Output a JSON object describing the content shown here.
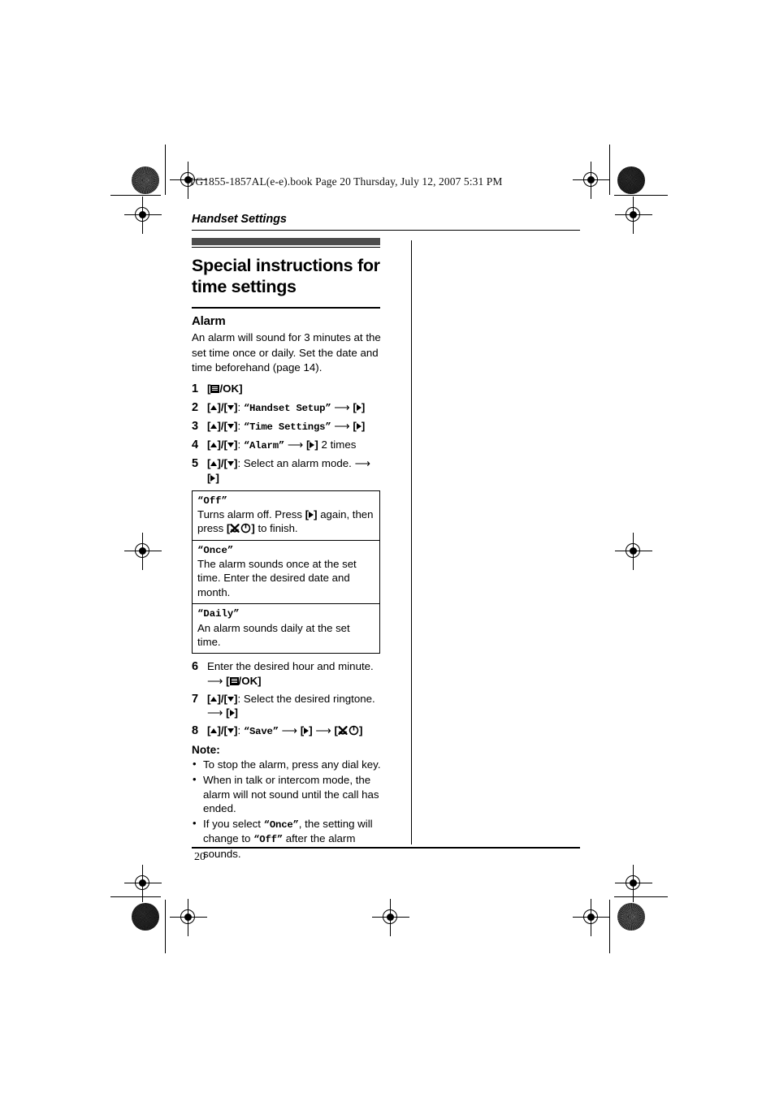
{
  "print_marks": {
    "book_header": "TG1855-1857AL(e-e).book  Page 20  Thursday, July 12, 2007  5:31 PM"
  },
  "page": {
    "running_head": "Handset Settings",
    "title": "Special instructions for time settings",
    "folio": "20"
  },
  "section": {
    "subhead": "Alarm",
    "intro": "An alarm will sound for 3 minutes at the set time once or daily. Set the date and time beforehand (page 14)."
  },
  "steps": [
    {
      "num": "1",
      "parts": [
        {
          "type": "key",
          "glyph": "menu-ok",
          "text": "[▤/OK]"
        }
      ]
    },
    {
      "num": "2",
      "parts": [
        {
          "type": "key",
          "glyph": "up-down",
          "text": "[▲]/[▼]"
        },
        {
          "type": "text",
          "text": ": "
        },
        {
          "type": "mono",
          "text": "“Handset Setup”"
        },
        {
          "type": "arrow",
          "text": "⟶"
        },
        {
          "type": "key",
          "glyph": "right",
          "text": "[►]"
        }
      ]
    },
    {
      "num": "3",
      "parts": [
        {
          "type": "key",
          "glyph": "up-down",
          "text": "[▲]/[▼]"
        },
        {
          "type": "text",
          "text": ": "
        },
        {
          "type": "mono",
          "text": "“Time Settings”"
        },
        {
          "type": "arrow",
          "text": "⟶"
        },
        {
          "type": "key",
          "glyph": "right",
          "text": "[►]"
        }
      ]
    },
    {
      "num": "4",
      "parts": [
        {
          "type": "key",
          "glyph": "up-down",
          "text": "[▲]/[▼]"
        },
        {
          "type": "text",
          "text": ": "
        },
        {
          "type": "mono",
          "text": "“Alarm”"
        },
        {
          "type": "arrow",
          "text": "⟶"
        },
        {
          "type": "key",
          "glyph": "right",
          "text": "[►]"
        },
        {
          "type": "text",
          "text": " 2 times"
        }
      ]
    },
    {
      "num": "5",
      "parts": [
        {
          "type": "key",
          "glyph": "up-down",
          "text": "[▲]/[▼]"
        },
        {
          "type": "text",
          "text": ": Select an alarm mode. "
        },
        {
          "type": "arrow",
          "text": "⟶"
        },
        {
          "type": "key",
          "glyph": "right",
          "text": "[►]"
        }
      ]
    }
  ],
  "options_table": [
    {
      "name": "“Off”",
      "desc_before": "Turns alarm off. Press ",
      "key1": "[►]",
      "desc_mid": " again, then press ",
      "key2": "[✘⏻]",
      "desc_after": " to finish."
    },
    {
      "name": "“Once”",
      "desc": "The alarm sounds once at the set time. Enter the desired date and month."
    },
    {
      "name": "“Daily”",
      "desc": "An alarm sounds daily at the set time."
    }
  ],
  "steps_cont": [
    {
      "num": "6",
      "parts": [
        {
          "type": "text",
          "text": "Enter the desired hour and minute. "
        },
        {
          "type": "arrow",
          "text": "⟶"
        },
        {
          "type": "key",
          "glyph": "menu-ok",
          "text": "[▤/OK]"
        }
      ]
    },
    {
      "num": "7",
      "parts": [
        {
          "type": "key",
          "glyph": "up-down",
          "text": "[▲]/[▼]"
        },
        {
          "type": "text",
          "text": ": Select the desired ringtone. "
        },
        {
          "type": "arrow",
          "text": "⟶"
        },
        {
          "type": "key",
          "glyph": "right",
          "text": "[►]"
        }
      ]
    },
    {
      "num": "8",
      "parts": [
        {
          "type": "key",
          "glyph": "up-down",
          "text": "[▲]/[▼]"
        },
        {
          "type": "text",
          "text": ": "
        },
        {
          "type": "mono",
          "text": "“Save”"
        },
        {
          "type": "arrow",
          "text": "⟶"
        },
        {
          "type": "key",
          "glyph": "right",
          "text": "[►]"
        },
        {
          "type": "arrow",
          "text": "⟶"
        },
        {
          "type": "key",
          "glyph": "offhook-power",
          "text": "[✘⏻]"
        }
      ]
    }
  ],
  "note": {
    "heading": "Note:",
    "items": [
      {
        "text": "To stop the alarm, press any dial key."
      },
      {
        "text": "When in talk or intercom mode, the alarm will not sound until the call has ended."
      },
      {
        "prefix": "If you select ",
        "mono1": "“Once”",
        "mid": ", the setting will change to ",
        "mono2": "“Off”",
        "suffix": " after the alarm sounds."
      }
    ]
  },
  "colors": {
    "band": "#4d4d4d",
    "rule": "#000000"
  }
}
